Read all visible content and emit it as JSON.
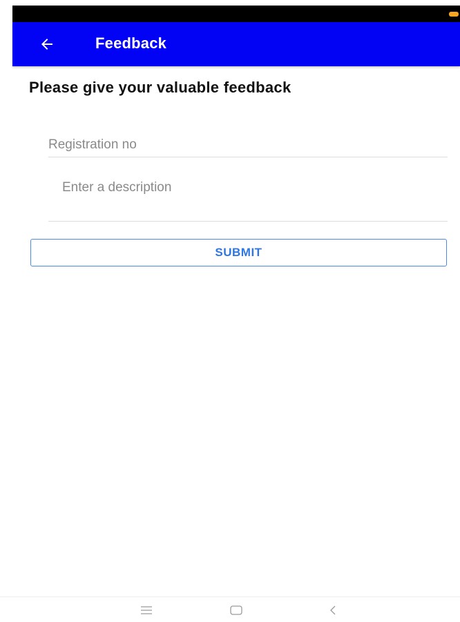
{
  "app_bar": {
    "title": "Feedback",
    "background_color": "#0202f5",
    "back_icon": "arrow-left-icon"
  },
  "content": {
    "heading": "Please give your valuable feedback",
    "registration_field": {
      "placeholder": "Registration no",
      "value": ""
    },
    "description_field": {
      "placeholder": "Enter a description",
      "value": ""
    },
    "submit_label": "SUBMIT",
    "accent_color": "#2f76e3"
  },
  "system_nav": {
    "icons": [
      "menu-icon",
      "home-icon",
      "back-chevron-icon"
    ]
  },
  "status_bar": {
    "battery_color": "#f5a623"
  }
}
